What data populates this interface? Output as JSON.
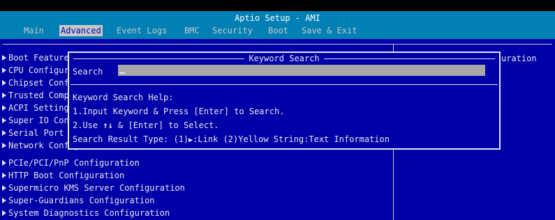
{
  "title": "Aptio Setup - AMI",
  "tabs": [
    "Main",
    "Advanced",
    "Event Logs",
    "BMC",
    "Security",
    "Boot",
    "Save & Exit"
  ],
  "active_tab": "Advanced",
  "left_items": [
    "Boot Feature",
    "CPU Configuration",
    "Chipset Configuration",
    "Trusted Computing",
    "ACPI Settings",
    "Super IO Configuration",
    "Serial Port Console Redirection",
    "Network Configuration",
    "PCIe/PCI/PnP Configuration",
    "HTTP Boot Configuration",
    "Supermicro KMS Server Configuration",
    "Super-Guardians Configuration",
    "System Diagnostics Configuration"
  ],
  "right_panel_text": "uration",
  "dialog": {
    "title": "Keyword Search",
    "search_label": "Search",
    "search_value": "",
    "help_title": "Keyword Search Help:",
    "help1": "1.Input Keyword & Press [Enter] to Search.",
    "help2_a": "2.Use ",
    "help2_arrows": "↑↓",
    "help2_b": " & [Enter] to Select.",
    "help3_a": "Search Result Type: (1)",
    "help3_icon": "▶",
    "help3_b": ":Link (2)Yellow String:Text Information"
  }
}
